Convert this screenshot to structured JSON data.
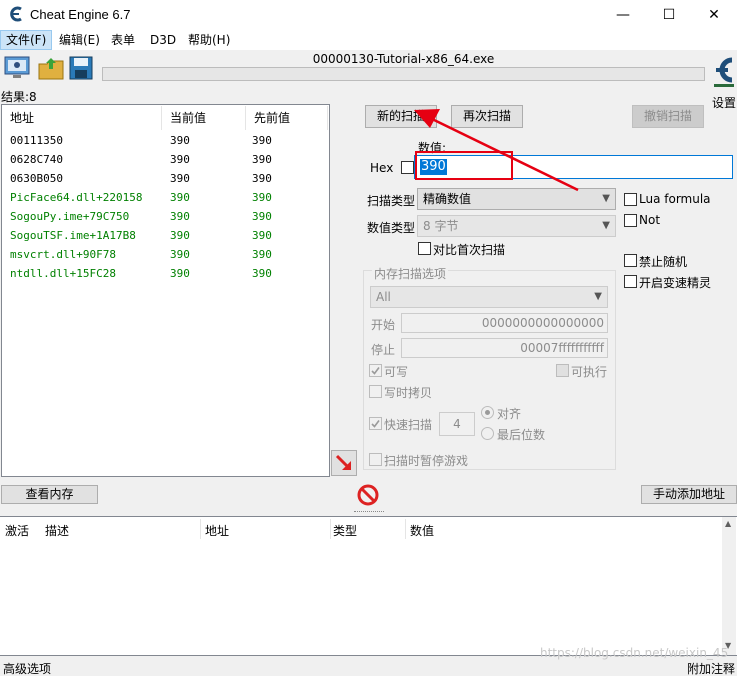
{
  "window": {
    "title": "Cheat Engine 6.7",
    "min": "—",
    "max": "☐",
    "close": "✕"
  },
  "menu": [
    "文件(F)",
    "编辑(E)",
    "表单",
    "D3D",
    "帮助(H)"
  ],
  "toolbar": {
    "process": "00000130-Tutorial-x86_64.exe",
    "settings": "设置"
  },
  "results": {
    "label": "结果:8",
    "columns": [
      "地址",
      "当前值",
      "先前值"
    ],
    "rows": [
      {
        "addr": "00111350",
        "cur": "390",
        "prev": "390",
        "color": "#000000"
      },
      {
        "addr": "0628C740",
        "cur": "390",
        "prev": "390",
        "color": "#000000"
      },
      {
        "addr": "0630B050",
        "cur": "390",
        "prev": "390",
        "color": "#000000"
      },
      {
        "addr": "PicFace64.dll+220158",
        "cur": "390",
        "prev": "390",
        "color": "#008000"
      },
      {
        "addr": "SogouPy.ime+79C750",
        "cur": "390",
        "prev": "390",
        "color": "#008000"
      },
      {
        "addr": "SogouTSF.ime+1A17B8",
        "cur": "390",
        "prev": "390",
        "color": "#008000"
      },
      {
        "addr": "msvcrt.dll+90F78",
        "cur": "390",
        "prev": "390",
        "color": "#008000"
      },
      {
        "addr": "ntdll.dll+15FC28",
        "cur": "390",
        "prev": "390",
        "color": "#008000"
      }
    ]
  },
  "scan": {
    "new_scan": "新的扫描",
    "next_scan": "再次扫描",
    "undo_scan": "撤销扫描",
    "value_label": "数值:",
    "hex_label": "Hex",
    "value": "390",
    "scan_type_label": "扫描类型",
    "scan_type": "精确数值",
    "value_type_label": "数值类型",
    "value_type": "8 字节",
    "compare_first": "对比首次扫描",
    "lua_formula": "Lua formula",
    "not": "Not",
    "disable_random": "禁止随机",
    "speedhack": "开启变速精灵"
  },
  "memory_options": {
    "title": "内存扫描选项",
    "region": "All",
    "start_label": "开始",
    "start": "0000000000000000",
    "stop_label": "停止",
    "stop": "00007fffffffffff",
    "writable": "可写",
    "executable": "可执行",
    "copy_on_write": "写时拷贝",
    "fast_scan": "快速扫描",
    "fast_scan_value": "4",
    "align": "对齐",
    "last_digits": "最后位数",
    "pause_game": "扫描时暂停游戏"
  },
  "actions": {
    "view_memory": "查看内存",
    "add_address": "手动添加地址"
  },
  "address_table": {
    "columns": [
      "激活",
      "描述",
      "地址",
      "类型",
      "数值"
    ]
  },
  "status": {
    "advanced": "高级选项",
    "comments": "附加注释",
    "watermark": "https://blog.csdn.net/weixin_45"
  },
  "colors": {
    "highlight": "#0078d7",
    "annotation": "#e60012",
    "green_entry": "#008000"
  }
}
